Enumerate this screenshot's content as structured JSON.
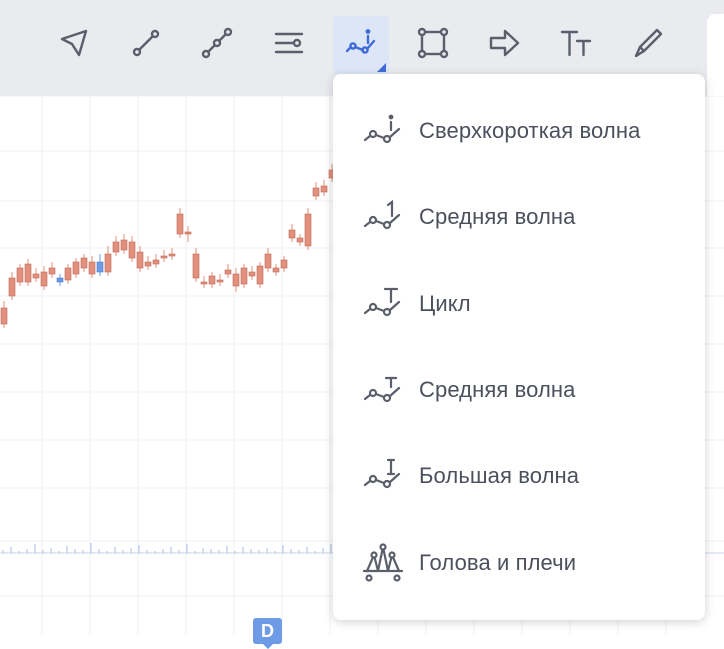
{
  "toolbar": {
    "tools": [
      {
        "name": "cursor-arrow-icon"
      },
      {
        "name": "trend-line-icon"
      },
      {
        "name": "multi-point-line-icon"
      },
      {
        "name": "parallel-channel-icon"
      },
      {
        "name": "wave-pattern-icon",
        "active": true
      },
      {
        "name": "rectangle-icon"
      },
      {
        "name": "arrow-shape-icon"
      },
      {
        "name": "text-icon"
      },
      {
        "name": "brush-icon"
      }
    ]
  },
  "chart": {
    "marker_label": "D"
  },
  "menu": {
    "items": [
      {
        "label": "Сверхкороткая волна",
        "icon": "wave-i-icon"
      },
      {
        "label": "Средняя волна",
        "icon": "wave-1-icon"
      },
      {
        "label": "Цикл",
        "icon": "wave-t-icon"
      },
      {
        "label": "Средняя волна",
        "icon": "wave-t-small-icon"
      },
      {
        "label": "Большая волна",
        "icon": "wave-I-icon"
      },
      {
        "label": "Голова и плечи",
        "icon": "head-shoulders-icon"
      }
    ]
  },
  "colors": {
    "up_candle": "#6e9ae6",
    "down_candle": "#e0907c",
    "accent": "#3f6bd8",
    "icon": "#5a5f6b"
  }
}
